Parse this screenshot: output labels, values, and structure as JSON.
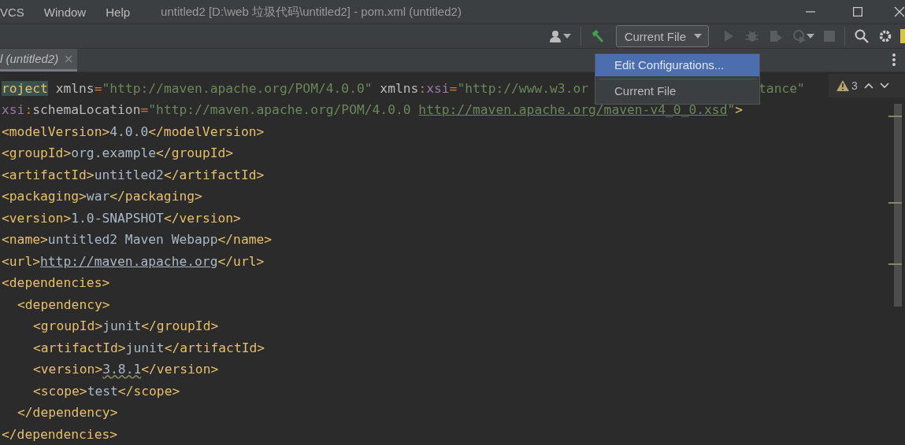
{
  "menu_bar": [
    {
      "label": "VCS"
    },
    {
      "label": "Window"
    },
    {
      "label": "Help"
    }
  ],
  "window": {
    "title": "untitled2 [D:\\web 垃圾代码\\untitled2] - pom.xml (untitled2)"
  },
  "toolbar": {
    "run_config": {
      "label": "Current File",
      "expanded": true
    },
    "run_menu": [
      {
        "label": "Edit Configurations...",
        "selected": true
      },
      {
        "label": "Current File",
        "selected": false
      }
    ]
  },
  "tabs": [
    {
      "label": "l (untitled2)",
      "selected": true
    }
  ],
  "inspection": {
    "warnings": "3"
  },
  "editor": {
    "lines": [
      {
        "tokens": [
          {
            "kind": "match",
            "text": "roject"
          },
          {
            "kind": "attr",
            "text": " xmlns"
          },
          {
            "kind": "punct",
            "text": "="
          },
          {
            "kind": "str",
            "text": "\"http://maven.apache.org/POM/4.0.0\""
          },
          {
            "kind": "attr",
            "text": " xmlns"
          },
          {
            "kind": "punct",
            "text": ":"
          },
          {
            "kind": "ns",
            "text": "xsi"
          },
          {
            "kind": "punct",
            "text": "="
          },
          {
            "kind": "str",
            "text": "\"http://www.w3.or"
          }
        ],
        "tail": [
          {
            "kind": "str",
            "text": "tance\""
          }
        ]
      },
      {
        "tokens": [
          {
            "kind": "ns",
            "text": "xsi"
          },
          {
            "kind": "punct",
            "text": ":"
          },
          {
            "kind": "attr",
            "text": "schemaLocation"
          },
          {
            "kind": "punct",
            "text": "="
          },
          {
            "kind": "str",
            "text": "\"http://maven.apache.org/POM/4.0.0 "
          },
          {
            "kind": "strlink",
            "text": "http://maven.apache.org/maven-v4_0_0.xsd"
          },
          {
            "kind": "str",
            "text": "\""
          },
          {
            "kind": "tag",
            "text": ">"
          }
        ]
      },
      {
        "tokens": [
          {
            "kind": "tag",
            "text": "<modelVersion>"
          },
          {
            "kind": "text",
            "text": "4.0.0"
          },
          {
            "kind": "tag",
            "text": "</modelVersion>"
          }
        ]
      },
      {
        "tokens": [
          {
            "kind": "tag",
            "text": "<groupId>"
          },
          {
            "kind": "text",
            "text": "org.example"
          },
          {
            "kind": "tag",
            "text": "</groupId>"
          }
        ]
      },
      {
        "tokens": [
          {
            "kind": "tag",
            "text": "<artifactId>"
          },
          {
            "kind": "text",
            "text": "untitled2"
          },
          {
            "kind": "tag",
            "text": "</artifactId>"
          }
        ]
      },
      {
        "tokens": [
          {
            "kind": "tag",
            "text": "<packaging>"
          },
          {
            "kind": "text",
            "text": "war"
          },
          {
            "kind": "tag",
            "text": "</packaging>"
          }
        ]
      },
      {
        "tokens": [
          {
            "kind": "tag",
            "text": "<version>"
          },
          {
            "kind": "text",
            "text": "1.0-SNAPSHOT"
          },
          {
            "kind": "tag",
            "text": "</version>"
          }
        ]
      },
      {
        "tokens": [
          {
            "kind": "tag",
            "text": "<name>"
          },
          {
            "kind": "text",
            "text": "untitled2 Maven Webapp"
          },
          {
            "kind": "tag",
            "text": "</name>"
          }
        ]
      },
      {
        "tokens": [
          {
            "kind": "tag",
            "text": "<url>"
          },
          {
            "kind": "link",
            "text": "http://maven.apache.org"
          },
          {
            "kind": "tag",
            "text": "</url>"
          }
        ]
      },
      {
        "tokens": [
          {
            "kind": "tag",
            "text": "<dependencies>"
          }
        ],
        "children": [
          {
            "tokens": [
              {
                "kind": "tag",
                "text": "<dependency>"
              }
            ],
            "children": [
              {
                "tokens": [
                  {
                    "kind": "tag",
                    "text": "<groupId>"
                  },
                  {
                    "kind": "text",
                    "text": "junit"
                  },
                  {
                    "kind": "tag",
                    "text": "</groupId>"
                  }
                ]
              },
              {
                "tokens": [
                  {
                    "kind": "tag",
                    "text": "<artifactId>"
                  },
                  {
                    "kind": "text",
                    "text": "junit"
                  },
                  {
                    "kind": "tag",
                    "text": "</artifactId>"
                  }
                ]
              },
              {
                "tokens": [
                  {
                    "kind": "tag",
                    "text": "<version>"
                  },
                  {
                    "kind": "warn",
                    "text": "3.8.1"
                  },
                  {
                    "kind": "tag",
                    "text": "</version>"
                  }
                ]
              },
              {
                "tokens": [
                  {
                    "kind": "tag",
                    "text": "<scope>"
                  },
                  {
                    "kind": "text",
                    "text": "test"
                  },
                  {
                    "kind": "tag",
                    "text": "</scope>"
                  }
                ]
              }
            ]
          },
          {
            "tokens": [
              {
                "kind": "tag",
                "text": "</dependency>"
              }
            ]
          }
        ]
      },
      {
        "tokens": [
          {
            "kind": "tag",
            "text": "</dependencies>"
          }
        ]
      }
    ]
  }
}
